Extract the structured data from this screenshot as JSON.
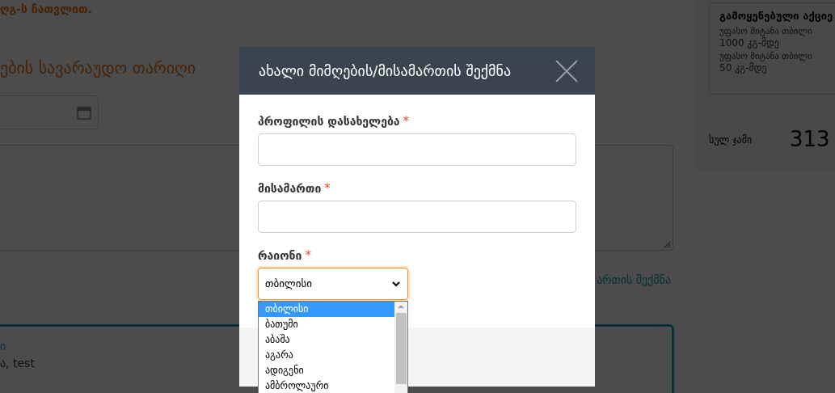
{
  "page": {
    "note": "ღგ-ს ჩათვლით.",
    "heading": "ების სავარაუდო თარიღი",
    "link": "ართის შექმნა",
    "card": {
      "line_1": "ი",
      "line_2": "ა, test"
    }
  },
  "sidebar": {
    "promo_title": "გამოყენებული აქციე",
    "promo_items": [
      {
        "title": "უფასო მიტანა თბილი",
        "detail": "1000 კგ-მდე"
      },
      {
        "title": "უფასო მიტანა თბილი",
        "detail": "50 კგ-მდე"
      }
    ],
    "total_label": "სულ ჯამი",
    "total_value": "313"
  },
  "dialog": {
    "title": "ახალი მიმღების/მისამართის შექმნა",
    "fields": [
      {
        "kind": "text",
        "label": "პროფილის დასახელება",
        "required_mark": "*"
      },
      {
        "kind": "text",
        "label": "მისამართი",
        "required_mark": "*"
      },
      {
        "kind": "select",
        "label": "რაიონი",
        "required_mark": "*",
        "value": "თბილისი",
        "expanded": true,
        "options": [
          {
            "label": "თბილისი",
            "selected": true
          },
          {
            "label": "ბათუმი",
            "selected": false
          },
          {
            "label": "აბაშა",
            "selected": false
          },
          {
            "label": "აგარა",
            "selected": false
          },
          {
            "label": "ადიგენი",
            "selected": false
          },
          {
            "label": "ამბროლაური",
            "selected": false
          }
        ]
      }
    ]
  }
}
